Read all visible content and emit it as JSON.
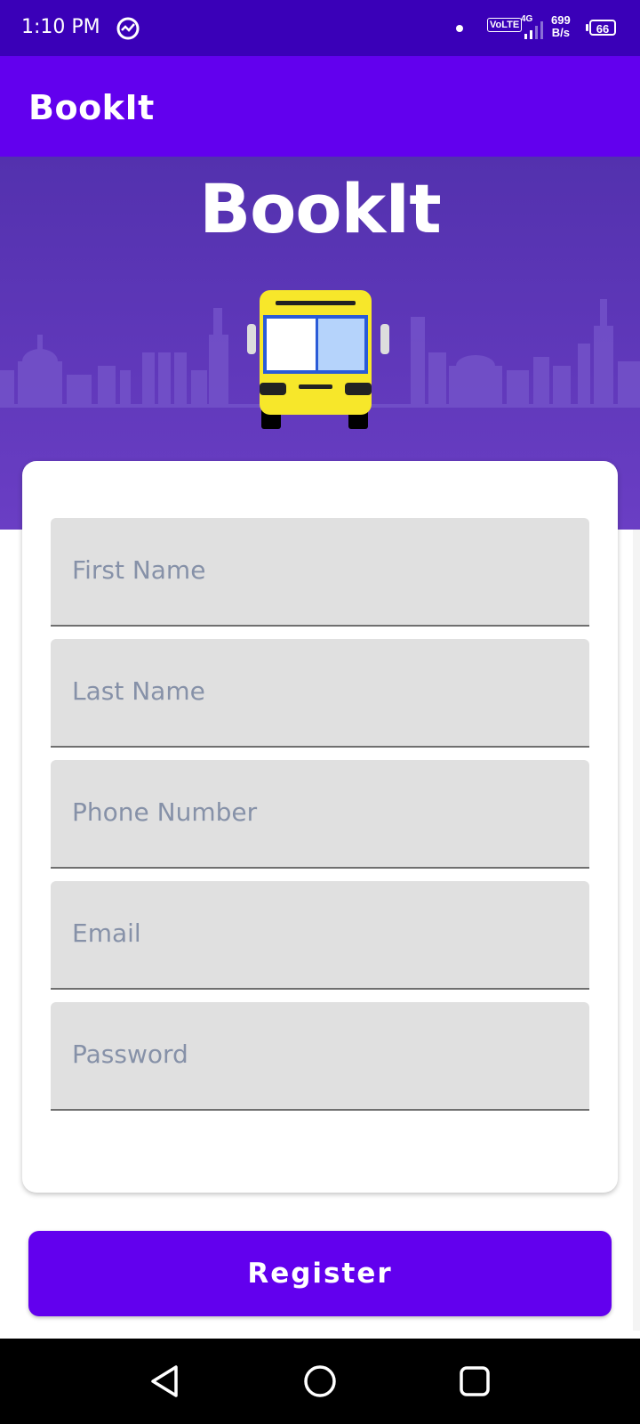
{
  "status_bar": {
    "time": "1:10 PM",
    "network": "VoLTE",
    "network_type": "4G",
    "speed_value": "699",
    "speed_unit": "B/s",
    "battery": "66"
  },
  "app_bar": {
    "title": "BookIt"
  },
  "hero": {
    "logo_text": "BookIt"
  },
  "form": {
    "fields": [
      {
        "placeholder": "First Name"
      },
      {
        "placeholder": "Last Name"
      },
      {
        "placeholder": "Phone Number"
      },
      {
        "placeholder": "Email"
      },
      {
        "placeholder": "Password"
      }
    ]
  },
  "register_button": {
    "label": "Register"
  },
  "colors": {
    "status_bar": "#3a00b8",
    "primary": "#6200ee",
    "hero": "#5a35b8",
    "field_bg": "#e0e0e0",
    "placeholder": "#8691a8",
    "bus_yellow": "#f7e72a"
  },
  "icons": [
    "sync-icon",
    "signal-icon",
    "battery-icon",
    "back-icon",
    "home-icon",
    "recents-icon",
    "bus-illustration"
  ]
}
